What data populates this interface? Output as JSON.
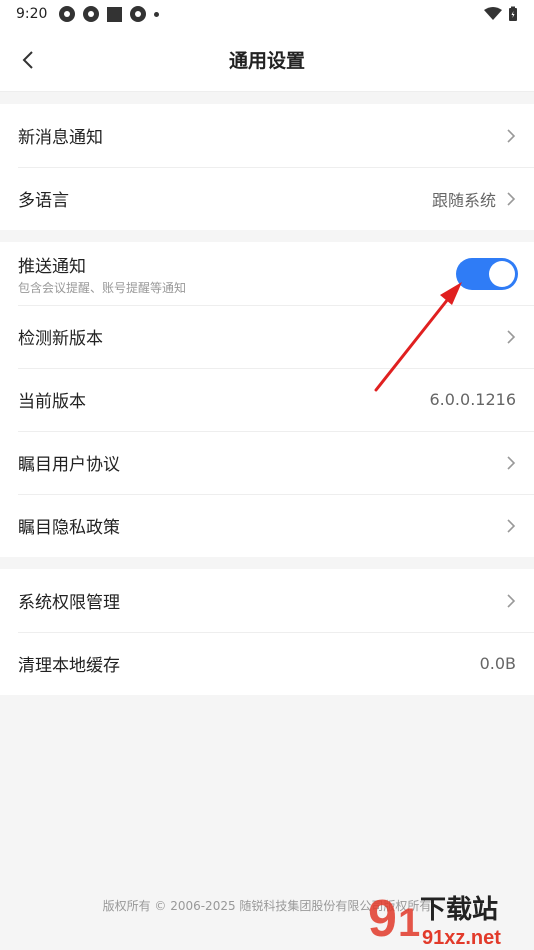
{
  "status": {
    "time": "9:20"
  },
  "header": {
    "title": "通用设置"
  },
  "group1": [
    {
      "label": "新消息通知",
      "value": ""
    },
    {
      "label": "多语言",
      "value": "跟随系统"
    }
  ],
  "group2": {
    "push": {
      "label": "推送通知",
      "sub": "包含会议提醒、账号提醒等通知",
      "on": true
    },
    "rows": [
      {
        "label": "检测新版本",
        "value": ""
      },
      {
        "label": "当前版本",
        "value": "6.0.0.1216"
      },
      {
        "label": "瞩目用户协议",
        "value": ""
      },
      {
        "label": "瞩目隐私政策",
        "value": ""
      }
    ]
  },
  "group3": [
    {
      "label": "系统权限管理",
      "value": ""
    },
    {
      "label": "清理本地缓存",
      "value": "0.0B"
    }
  ],
  "footer": {
    "copyright": "版权所有 © 2006-2025 随锐科技集团股份有限公司版权所有"
  },
  "watermark": {
    "text": "下载站",
    "url": "91xz.net"
  },
  "colors": {
    "accent": "#2f7cf6",
    "annotation": "#e02020"
  }
}
